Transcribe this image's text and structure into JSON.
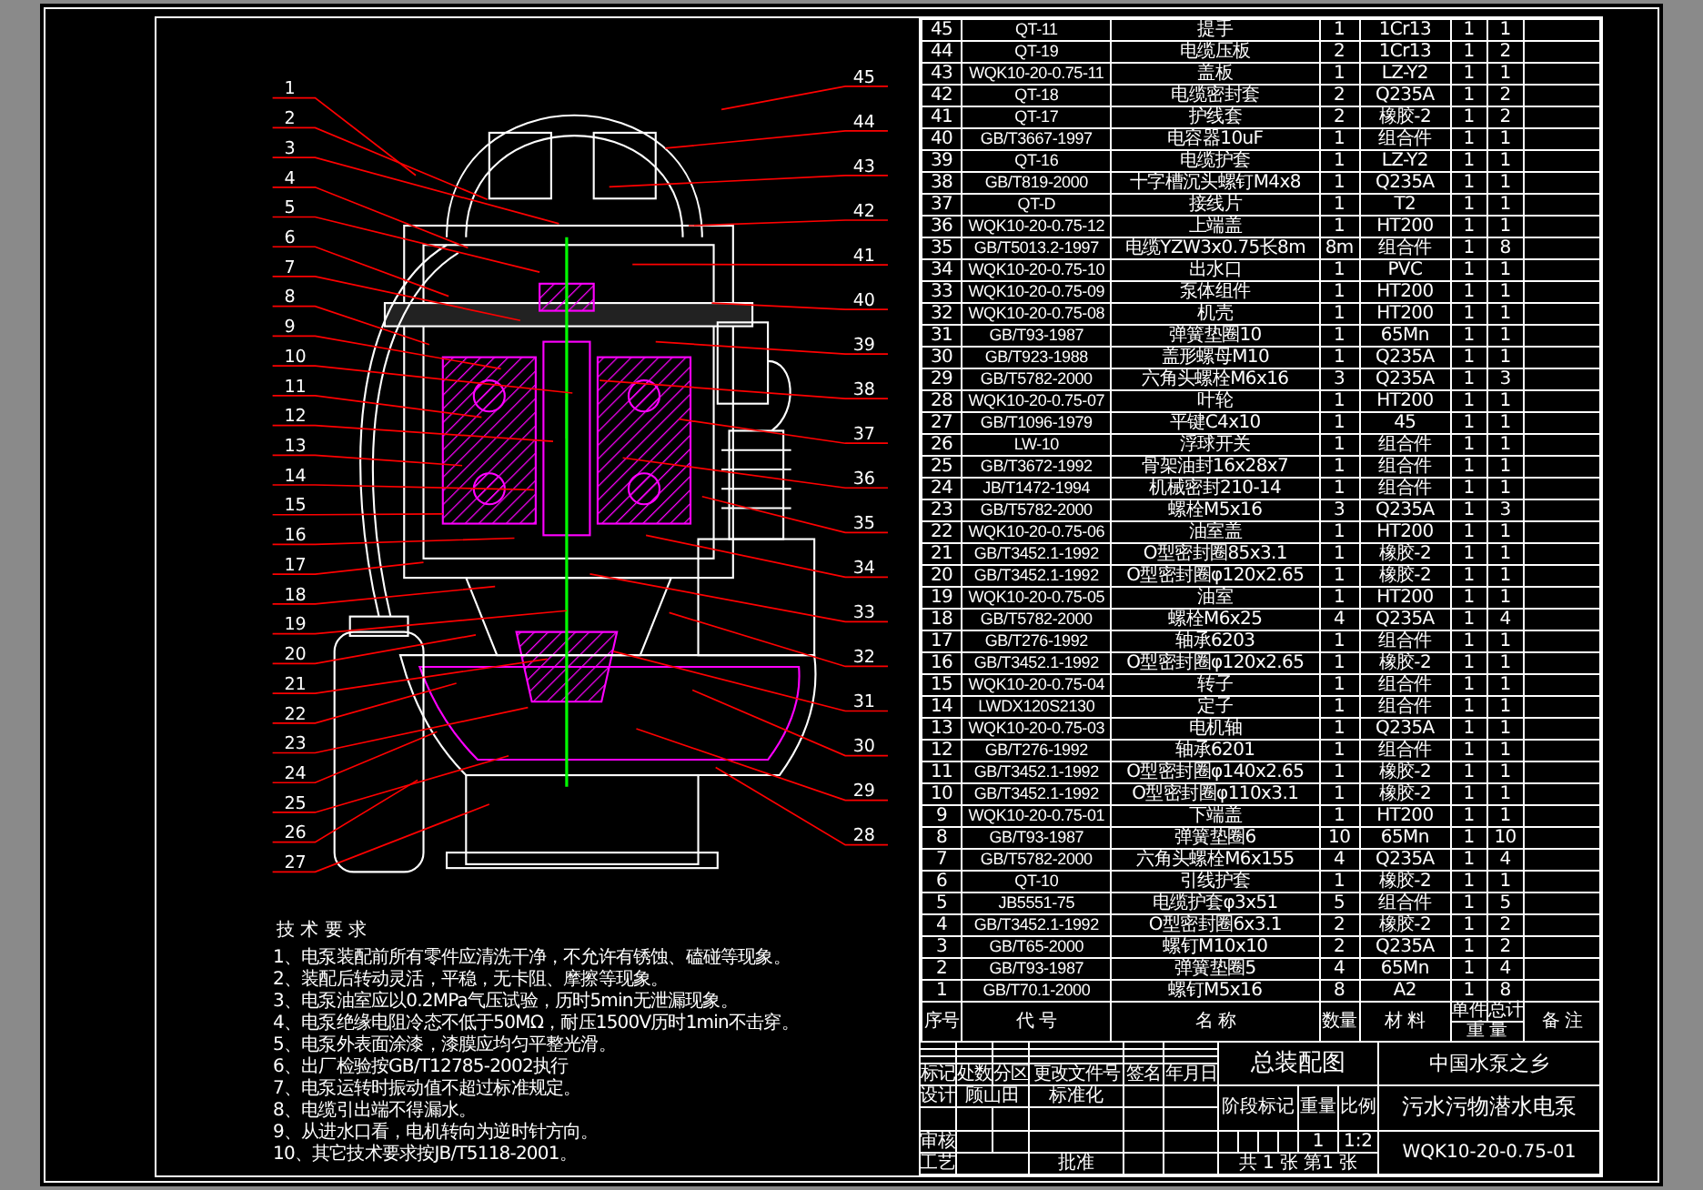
{
  "drawing": {
    "left_callouts": [
      "1",
      "2",
      "3",
      "4",
      "5",
      "6",
      "7",
      "8",
      "9",
      "10",
      "11",
      "12",
      "13",
      "14",
      "15",
      "16",
      "17",
      "18",
      "19",
      "20",
      "21",
      "22",
      "23",
      "24",
      "25",
      "26",
      "27"
    ],
    "right_callouts": [
      "45",
      "44",
      "43",
      "42",
      "41",
      "40",
      "39",
      "38",
      "37",
      "36",
      "35",
      "34",
      "33",
      "32",
      "31",
      "30",
      "29",
      "28"
    ]
  },
  "technical_requirements": {
    "title": "技 术 要 求",
    "items": [
      "1、电泵装配前所有零件应清洗干净，不允许有锈蚀、磕碰等现象。",
      "2、装配后转动灵活，平稳，无卡阻、摩擦等现象。",
      "3、电泵油室应以0.2MPa气压试验，历时5min无泄漏现象。",
      "4、电泵绝缘电阻冷态不低于50MΩ，耐压1500V历时1min不击穿。",
      "5、电泵外表面涂漆，漆膜应均匀平整光滑。",
      "6、出厂检验按GB/T12785-2002执行",
      "7、电泵运转时振动值不超过标准规定。",
      "8、电缆引出端不得漏水。",
      "9、从进水口看，电机转向为逆时针方向。",
      "10、其它技术要求按JB/T5118-2001。"
    ]
  },
  "parts_list": {
    "header": {
      "no": "序号",
      "code": "代 号",
      "name": "名 称",
      "qty": "数量",
      "material": "材 料",
      "unit_weight": "单件",
      "total_weight": "总计",
      "weight": "重 量",
      "note": "备 注"
    },
    "rows": [
      {
        "no": "45",
        "code": "QT-11",
        "name": "提手",
        "qty": "1",
        "material": "1Cr13",
        "unit_weight": "1",
        "total_weight": "1"
      },
      {
        "no": "44",
        "code": "QT-19",
        "name": "电缆压板",
        "qty": "2",
        "material": "1Cr13",
        "unit_weight": "1",
        "total_weight": "2"
      },
      {
        "no": "43",
        "code": "WQK10-20-0.75-11",
        "name": "盖板",
        "qty": "1",
        "material": "LZ-Y2",
        "unit_weight": "1",
        "total_weight": "1"
      },
      {
        "no": "42",
        "code": "QT-18",
        "name": "电缆密封套",
        "qty": "2",
        "material": "Q235A",
        "unit_weight": "1",
        "total_weight": "2"
      },
      {
        "no": "41",
        "code": "QT-17",
        "name": "护线套",
        "qty": "2",
        "material": "橡胶-2",
        "unit_weight": "1",
        "total_weight": "2"
      },
      {
        "no": "40",
        "code": "GB/T3667-1997",
        "name": "电容器10uF",
        "qty": "1",
        "material": "组合件",
        "unit_weight": "1",
        "total_weight": "1"
      },
      {
        "no": "39",
        "code": "QT-16",
        "name": "电缆护套",
        "qty": "1",
        "material": "LZ-Y2",
        "unit_weight": "1",
        "total_weight": "1"
      },
      {
        "no": "38",
        "code": "GB/T819-2000",
        "name": "十字槽沉头螺钉M4x8",
        "qty": "1",
        "material": "Q235A",
        "unit_weight": "1",
        "total_weight": "1"
      },
      {
        "no": "37",
        "code": "QT-D",
        "name": "接线片",
        "qty": "1",
        "material": "T2",
        "unit_weight": "1",
        "total_weight": "1"
      },
      {
        "no": "36",
        "code": "WQK10-20-0.75-12",
        "name": "上端盖",
        "qty": "1",
        "material": "HT200",
        "unit_weight": "1",
        "total_weight": "1"
      },
      {
        "no": "35",
        "code": "GB/T5013.2-1997",
        "name": "电缆YZW3x0.75长8m",
        "qty": "8m",
        "material": "组合件",
        "unit_weight": "1",
        "total_weight": "8"
      },
      {
        "no": "34",
        "code": "WQK10-20-0.75-10",
        "name": "出水口",
        "qty": "1",
        "material": "PVC",
        "unit_weight": "1",
        "total_weight": "1"
      },
      {
        "no": "33",
        "code": "WQK10-20-0.75-09",
        "name": "泵体组件",
        "qty": "1",
        "material": "HT200",
        "unit_weight": "1",
        "total_weight": "1"
      },
      {
        "no": "32",
        "code": "WQK10-20-0.75-08",
        "name": "机壳",
        "qty": "1",
        "material": "HT200",
        "unit_weight": "1",
        "total_weight": "1"
      },
      {
        "no": "31",
        "code": "GB/T93-1987",
        "name": "弹簧垫圈10",
        "qty": "1",
        "material": "65Mn",
        "unit_weight": "1",
        "total_weight": "1"
      },
      {
        "no": "30",
        "code": "GB/T923-1988",
        "name": "盖形螺母M10",
        "qty": "1",
        "material": "Q235A",
        "unit_weight": "1",
        "total_weight": "1"
      },
      {
        "no": "29",
        "code": "GB/T5782-2000",
        "name": "六角头螺栓M6x16",
        "qty": "3",
        "material": "Q235A",
        "unit_weight": "1",
        "total_weight": "3"
      },
      {
        "no": "28",
        "code": "WQK10-20-0.75-07",
        "name": "叶轮",
        "qty": "1",
        "material": "HT200",
        "unit_weight": "1",
        "total_weight": "1"
      },
      {
        "no": "27",
        "code": "GB/T1096-1979",
        "name": "平键C4x10",
        "qty": "1",
        "material": "45",
        "unit_weight": "1",
        "total_weight": "1"
      },
      {
        "no": "26",
        "code": "LW-10",
        "name": "浮球开关",
        "qty": "1",
        "material": "组合件",
        "unit_weight": "1",
        "total_weight": "1"
      },
      {
        "no": "25",
        "code": "GB/T3672-1992",
        "name": "骨架油封16x28x7",
        "qty": "1",
        "material": "组合件",
        "unit_weight": "1",
        "total_weight": "1"
      },
      {
        "no": "24",
        "code": "JB/T1472-1994",
        "name": "机械密封210-14",
        "qty": "1",
        "material": "组合件",
        "unit_weight": "1",
        "total_weight": "1"
      },
      {
        "no": "23",
        "code": "GB/T5782-2000",
        "name": "螺栓M5x16",
        "qty": "3",
        "material": "Q235A",
        "unit_weight": "1",
        "total_weight": "3"
      },
      {
        "no": "22",
        "code": "WQK10-20-0.75-06",
        "name": "油室盖",
        "qty": "1",
        "material": "HT200",
        "unit_weight": "1",
        "total_weight": "1"
      },
      {
        "no": "21",
        "code": "GB/T3452.1-1992",
        "name": "O型密封圈85x3.1",
        "qty": "1",
        "material": "橡胶-2",
        "unit_weight": "1",
        "total_weight": "1"
      },
      {
        "no": "20",
        "code": "GB/T3452.1-1992",
        "name": "O型密封圈φ120x2.65",
        "qty": "1",
        "material": "橡胶-2",
        "unit_weight": "1",
        "total_weight": "1"
      },
      {
        "no": "19",
        "code": "WQK10-20-0.75-05",
        "name": "油室",
        "qty": "1",
        "material": "HT200",
        "unit_weight": "1",
        "total_weight": "1"
      },
      {
        "no": "18",
        "code": "GB/T5782-2000",
        "name": "螺栓M6x25",
        "qty": "4",
        "material": "Q235A",
        "unit_weight": "1",
        "total_weight": "4"
      },
      {
        "no": "17",
        "code": "GB/T276-1992",
        "name": "轴承6203",
        "qty": "1",
        "material": "组合件",
        "unit_weight": "1",
        "total_weight": "1"
      },
      {
        "no": "16",
        "code": "GB/T3452.1-1992",
        "name": "O型密封圈φ120x2.65",
        "qty": "1",
        "material": "橡胶-2",
        "unit_weight": "1",
        "total_weight": "1"
      },
      {
        "no": "15",
        "code": "WQK10-20-0.75-04",
        "name": "转子",
        "qty": "1",
        "material": "组合件",
        "unit_weight": "1",
        "total_weight": "1"
      },
      {
        "no": "14",
        "code": "LWDX120S2130",
        "name": "定子",
        "qty": "1",
        "material": "组合件",
        "unit_weight": "1",
        "total_weight": "1"
      },
      {
        "no": "13",
        "code": "WQK10-20-0.75-03",
        "name": "电机轴",
        "qty": "1",
        "material": "Q235A",
        "unit_weight": "1",
        "total_weight": "1"
      },
      {
        "no": "12",
        "code": "GB/T276-1992",
        "name": "轴承6201",
        "qty": "1",
        "material": "组合件",
        "unit_weight": "1",
        "total_weight": "1"
      },
      {
        "no": "11",
        "code": "GB/T3452.1-1992",
        "name": "O型密封圈φ140x2.65",
        "qty": "1",
        "material": "橡胶-2",
        "unit_weight": "1",
        "total_weight": "1"
      },
      {
        "no": "10",
        "code": "GB/T3452.1-1992",
        "name": "O型密封圈φ110x3.1",
        "qty": "1",
        "material": "橡胶-2",
        "unit_weight": "1",
        "total_weight": "1"
      },
      {
        "no": "9",
        "code": "WQK10-20-0.75-01",
        "name": "下端盖",
        "qty": "1",
        "material": "HT200",
        "unit_weight": "1",
        "total_weight": "1"
      },
      {
        "no": "8",
        "code": "GB/T93-1987",
        "name": "弹簧垫圈6",
        "qty": "10",
        "material": "65Mn",
        "unit_weight": "1",
        "total_weight": "10"
      },
      {
        "no": "7",
        "code": "GB/T5782-2000",
        "name": "六角头螺栓M6x155",
        "qty": "4",
        "material": "Q235A",
        "unit_weight": "1",
        "total_weight": "4"
      },
      {
        "no": "6",
        "code": "QT-10",
        "name": "引线护套",
        "qty": "1",
        "material": "橡胶-2",
        "unit_weight": "1",
        "total_weight": "1"
      },
      {
        "no": "5",
        "code": "JB5551-75",
        "name": "电缆护套φ3x51",
        "qty": "5",
        "material": "组合件",
        "unit_weight": "1",
        "total_weight": "5"
      },
      {
        "no": "4",
        "code": "GB/T3452.1-1992",
        "name": "O型密封圈6x3.1",
        "qty": "2",
        "material": "橡胶-2",
        "unit_weight": "1",
        "total_weight": "2"
      },
      {
        "no": "3",
        "code": "GB/T65-2000",
        "name": "螺钉M10x10",
        "qty": "2",
        "material": "Q235A",
        "unit_weight": "1",
        "total_weight": "2"
      },
      {
        "no": "2",
        "code": "GB/T93-1987",
        "name": "弹簧垫圈5",
        "qty": "4",
        "material": "65Mn",
        "unit_weight": "1",
        "total_weight": "4"
      },
      {
        "no": "1",
        "code": "GB/T70.1-2000",
        "name": "螺钉M5x16",
        "qty": "8",
        "material": "A2",
        "unit_weight": "1",
        "total_weight": "8"
      }
    ]
  },
  "title_block": {
    "revision_headers": [
      "标记",
      "处数",
      "分区",
      "更改文件号",
      "签名",
      "年月日"
    ],
    "design_label": "设计",
    "designer": "顾山田",
    "standardization_label": "标准化",
    "review_label": "审核",
    "process_label": "工艺",
    "approval_label": "批准",
    "drawing_title": "总装配图",
    "stage_label": "阶段标记",
    "weight_label": "重量",
    "scale_label": "比例",
    "weight": "1",
    "scale": "1:2",
    "sheets": "共 1 张 第1 张",
    "company": "中国水泵之乡",
    "product": "污水污物潜水电泵",
    "drawing_number": "WQK10-20-0.75-01"
  }
}
